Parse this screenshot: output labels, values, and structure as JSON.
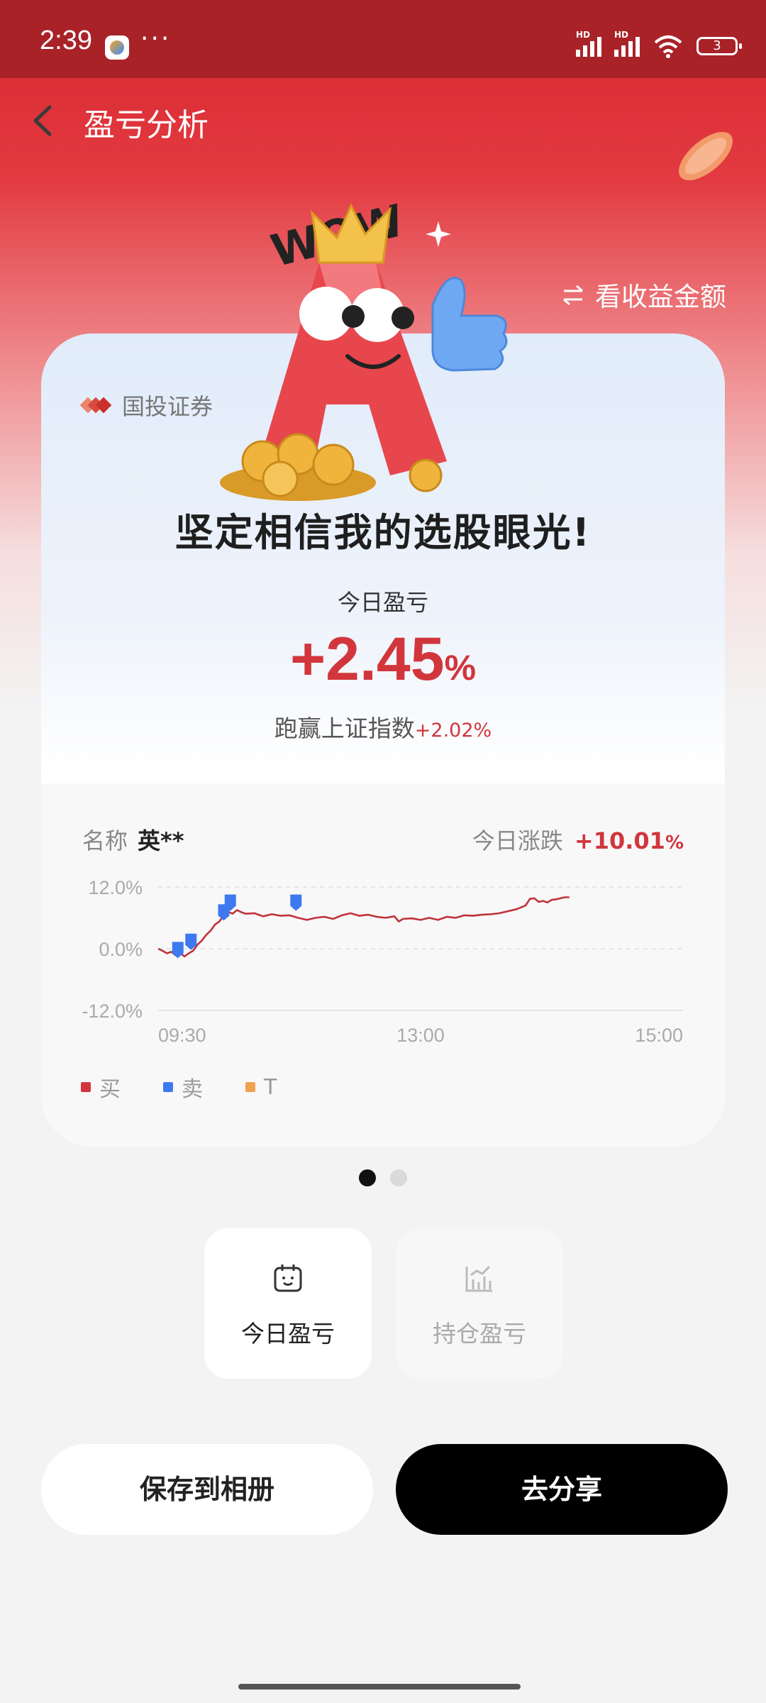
{
  "status_bar": {
    "time": "2:39",
    "more": "···",
    "battery": "3"
  },
  "nav": {
    "title": "盈亏分析"
  },
  "toggle": {
    "label": "看收益金额"
  },
  "illustration": {
    "wow_text": "WOW"
  },
  "card": {
    "broker": "国投证券",
    "slogan": "坚定相信我的选股眼光!",
    "pl_label": "今日盈亏",
    "pl_value": "+2.45",
    "pl_unit": "%",
    "beat_label": "跑赢上证指数",
    "beat_value": "+2.02%",
    "name_label": "名称",
    "name_value": "英**",
    "change_label": "今日涨跌",
    "change_value": "+10.01",
    "change_unit": "%"
  },
  "chart_data": {
    "type": "line",
    "y_ticks": [
      "12.0%",
      "0.0%",
      "-12.0%"
    ],
    "x_ticks": [
      "09:30",
      "13:00",
      "15:00"
    ],
    "ylim": [
      -12,
      12
    ],
    "line_color": "#c0323a",
    "series": [
      {
        "name": "",
        "points": [
          [
            0,
            0
          ],
          [
            2,
            -0.4
          ],
          [
            4,
            -0.9
          ],
          [
            6,
            -0.6
          ],
          [
            8,
            -1.3
          ],
          [
            10,
            -0.8
          ],
          [
            12,
            -1.5
          ],
          [
            14,
            -0.9
          ],
          [
            16,
            -0.4
          ],
          [
            18,
            0.8
          ],
          [
            20,
            1.6
          ],
          [
            22,
            2.7
          ],
          [
            24,
            3.5
          ],
          [
            26,
            4.7
          ],
          [
            28,
            5.3
          ],
          [
            30,
            6.5
          ],
          [
            32,
            7.2
          ],
          [
            34,
            6.8
          ],
          [
            36,
            7.5
          ],
          [
            38,
            7.1
          ],
          [
            40,
            6.8
          ],
          [
            44,
            6.9
          ],
          [
            48,
            6.3
          ],
          [
            52,
            6.7
          ],
          [
            56,
            6.4
          ],
          [
            60,
            6.5
          ],
          [
            64,
            6.0
          ],
          [
            68,
            5.6
          ],
          [
            72,
            6.0
          ],
          [
            76,
            6.2
          ],
          [
            80,
            5.8
          ],
          [
            84,
            6.5
          ],
          [
            88,
            6.9
          ],
          [
            92,
            6.4
          ],
          [
            96,
            6.6
          ],
          [
            100,
            6.2
          ],
          [
            104,
            6.0
          ],
          [
            108,
            6.3
          ],
          [
            110,
            5.3
          ],
          [
            112,
            5.8
          ],
          [
            116,
            5.9
          ],
          [
            120,
            5.6
          ],
          [
            124,
            6.0
          ],
          [
            128,
            5.6
          ],
          [
            132,
            6.2
          ],
          [
            136,
            6.0
          ],
          [
            140,
            6.5
          ],
          [
            144,
            6.4
          ],
          [
            148,
            6.6
          ],
          [
            152,
            6.7
          ],
          [
            156,
            6.9
          ],
          [
            160,
            7.3
          ],
          [
            164,
            7.7
          ],
          [
            168,
            8.4
          ],
          [
            170,
            9.7
          ],
          [
            172,
            9.8
          ],
          [
            174,
            9.1
          ],
          [
            176,
            9.3
          ],
          [
            178,
            9.0
          ],
          [
            180,
            9.5
          ],
          [
            182,
            9.6
          ],
          [
            184,
            9.8
          ],
          [
            186,
            10.0
          ],
          [
            188,
            10.0
          ]
        ]
      }
    ],
    "markers": [
      {
        "type": "卖",
        "x": 9,
        "y": -0.6
      },
      {
        "type": "卖",
        "x": 15,
        "y": 1.0
      },
      {
        "type": "卖",
        "x": 30,
        "y": 6.7
      },
      {
        "type": "卖",
        "x": 33,
        "y": 8.6
      },
      {
        "type": "卖",
        "x": 63,
        "y": 8.6
      }
    ],
    "legend": [
      {
        "label": "买",
        "color": "#d1363c"
      },
      {
        "label": "卖",
        "color": "#3d7af0"
      },
      {
        "label": "T",
        "color": "#f0a050"
      }
    ],
    "grid": true
  },
  "pager": {
    "count": 2,
    "active": 0
  },
  "tabs": [
    {
      "label": "今日盈亏",
      "active": true
    },
    {
      "label": "持仓盈亏",
      "active": false
    }
  ],
  "buttons": {
    "save": "保存到相册",
    "share": "去分享"
  }
}
